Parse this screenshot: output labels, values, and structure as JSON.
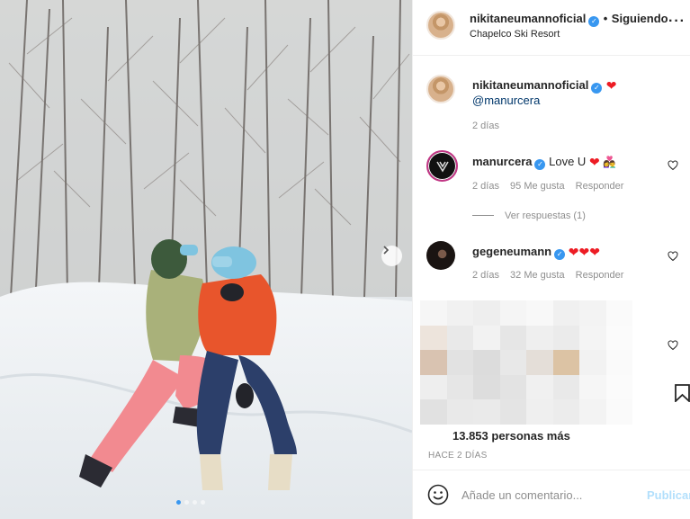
{
  "post": {
    "username": "nikitaneumannoficial",
    "follow_separator": "•",
    "follow_status": "Siguiendo",
    "location": "Chapelco Ski Resort",
    "more_icon": "more-horizontal-icon"
  },
  "caption": {
    "username": "nikitaneumannoficial",
    "emoji": "❤",
    "mention": "@manurcera",
    "time": "2 días"
  },
  "comments": [
    {
      "username": "manurcera",
      "text": "Love U",
      "emojis": "❤",
      "time": "2 días",
      "likes": "95 Me gusta",
      "reply": "Responder",
      "view_replies": "Ver respuestas (1)"
    },
    {
      "username": "gegeneumann",
      "emojis": "❤❤❤",
      "time": "2 días",
      "likes": "32 Me gusta",
      "reply": "Responder"
    }
  ],
  "likes_summary": "13.853 personas más",
  "post_age": "HACE 2 DÍAS",
  "composer": {
    "placeholder": "Añade un comentario...",
    "publish": "Publicar",
    "emoji_icon": "smiley-icon"
  },
  "colors": {
    "accent": "#3897f0",
    "publish_disabled": "#b2dffc",
    "heart": "#ed1c24",
    "jacket": "#e8552c",
    "helmet": "#7fc4e0"
  }
}
